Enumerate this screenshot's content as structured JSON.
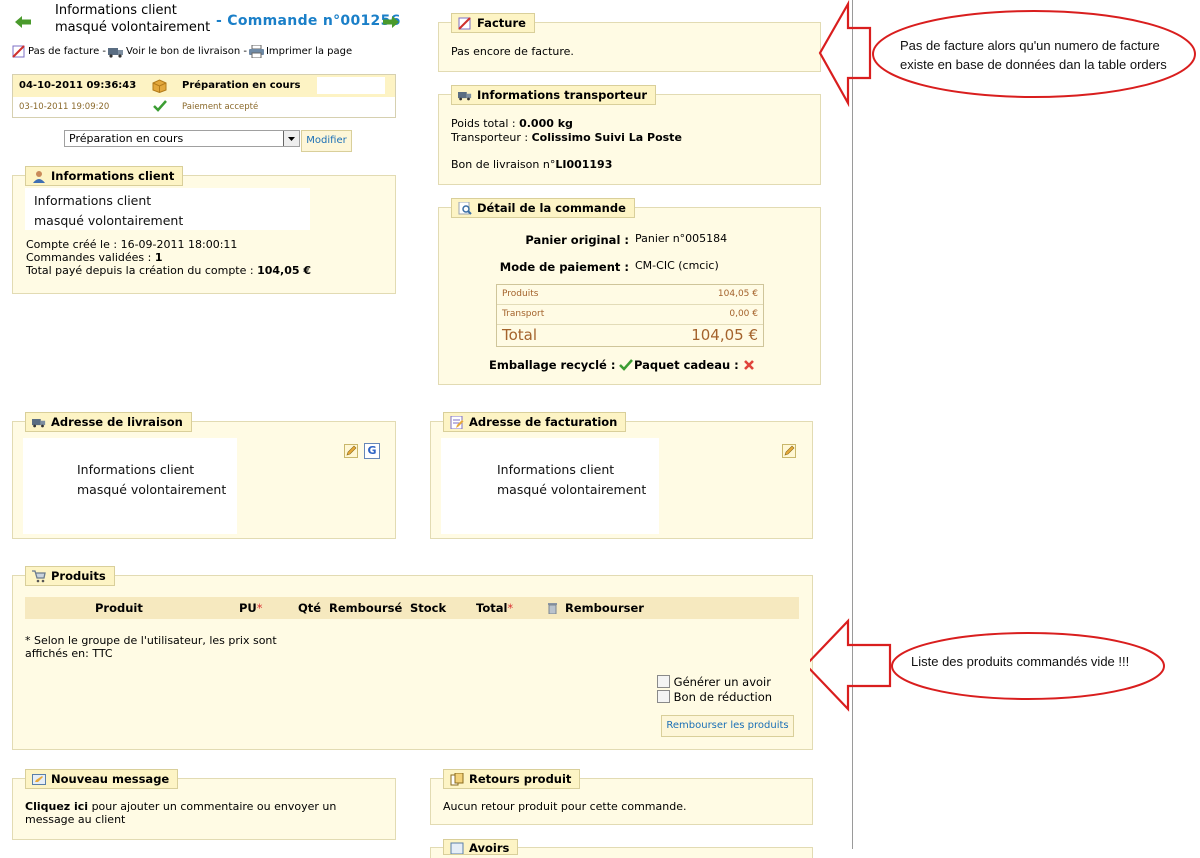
{
  "header": {
    "masked_line1": "Informations client",
    "masked_line2": "masqué volontairement",
    "command_title": "- Commande n°001256",
    "link_no_invoice": "Pas de facture -",
    "link_delivery": "Voir le bon de livraison -",
    "link_print": "Imprimer la page"
  },
  "status": {
    "rows": [
      {
        "date": "04-10-2011 09:36:43",
        "label": "Préparation en cours"
      },
      {
        "date": "03-10-2011 19:09:20",
        "label": "Paiement accepté"
      }
    ],
    "select_value": "Préparation en cours",
    "modify_label": "Modifier"
  },
  "client": {
    "legend": "Informations client",
    "masked_line1": "Informations client",
    "masked_line2": "masqué volontairement",
    "created_label": "Compte créé le : 16-09-2011 18:00:11",
    "orders_label": "Commandes validées : ",
    "orders_value": "1",
    "total_label": "Total payé depuis la création du compte : ",
    "total_value": "104,05 €"
  },
  "invoice": {
    "legend": "Facture",
    "text": "Pas encore de facture."
  },
  "carrier": {
    "legend": "Informations transporteur",
    "weight_label": "Poids total : ",
    "weight_value": "0.000 kg",
    "carrier_label": "Transporteur : ",
    "carrier_value": "Colissimo Suivi La Poste",
    "delivery_label": "Bon de livraison n°",
    "delivery_value": "LI001193"
  },
  "order_detail": {
    "legend": "Détail de la commande",
    "cart_label": "Panier original :",
    "cart_value": "Panier n°005184",
    "payment_label": "Mode de paiement :",
    "payment_value": "CM-CIC (cmcic)",
    "products_label": "Produits",
    "products_value": "104,05 €",
    "shipping_label": "Transport",
    "shipping_value": "0,00 €",
    "total_label": "Total",
    "total_value": "104,05 €",
    "recycled_label": "Emballage recyclé :",
    "gift_label": "Paquet cadeau :"
  },
  "delivery_address": {
    "legend": "Adresse de livraison",
    "masked_line1": "Informations client",
    "masked_line2": "masqué volontairement"
  },
  "billing_address": {
    "legend": "Adresse de facturation",
    "masked_line1": "Informations client",
    "masked_line2": "masqué volontairement"
  },
  "products": {
    "legend": "Produits",
    "columns": {
      "product": "Produit",
      "unit_price": "PU",
      "qty": "Qté",
      "refunded": "Remboursé",
      "stock": "Stock",
      "total": "Total",
      "refund": "Rembourser"
    },
    "asterisk": "*",
    "note_line1": "* Selon le groupe de l'utilisateur, les prix sont",
    "note_line2": "affichés en: TTC",
    "credit_label": "Générer un avoir",
    "voucher_label": "Bon de réduction",
    "refund_button": "Rembourser les produits"
  },
  "message": {
    "legend": "Nouveau message",
    "link": "Cliquez ici",
    "text_rest": " pour ajouter un commentaire ou envoyer un",
    "text_line2": "message au client"
  },
  "returns": {
    "legend": "Retours produit",
    "text": "Aucun retour produit pour cette commande."
  },
  "credits": {
    "legend": "Avoirs"
  },
  "annotations": {
    "invoice_note_line1": "Pas de facture alors qu'un numero de facture",
    "invoice_note_line2": "existe en base de données dan la table orders",
    "products_note": "Liste des produits commandés vide !!!"
  },
  "colors": {
    "annotation": "#d91e1e",
    "link_blue": "#1a7fc8",
    "panel_bg": "#fffbe4",
    "legend_bg": "#fdf4c5"
  }
}
